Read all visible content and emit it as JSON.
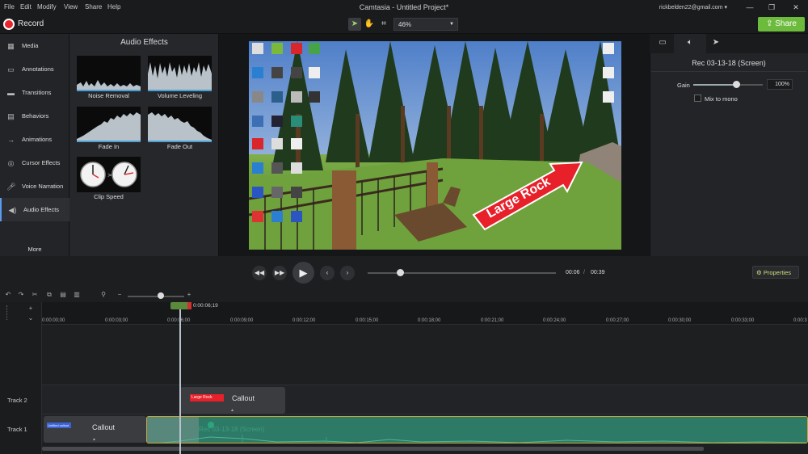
{
  "menu": [
    "File",
    "Edit",
    "Modify",
    "View",
    "Share",
    "Help"
  ],
  "window_title": "Camtasia - Untitled Project*",
  "user_email": "rickbelden22@gmail.com",
  "toolbar": {
    "record_label": "Record",
    "zoom": "46%",
    "share_label": "Share"
  },
  "sidebar": {
    "items": [
      {
        "label": "Media",
        "icon": "film-icon"
      },
      {
        "label": "Annotations",
        "icon": "annotation-icon"
      },
      {
        "label": "Transitions",
        "icon": "transition-icon"
      },
      {
        "label": "Behaviors",
        "icon": "behavior-icon"
      },
      {
        "label": "Animations",
        "icon": "animation-icon"
      },
      {
        "label": "Cursor Effects",
        "icon": "cursor-icon"
      },
      {
        "label": "Voice Narration",
        "icon": "microphone-icon"
      },
      {
        "label": "Audio Effects",
        "icon": "speaker-icon"
      }
    ],
    "active_index": 7,
    "more_label": "More"
  },
  "effects_panel": {
    "title": "Audio Effects",
    "items": [
      "Noise Removal",
      "Volume Leveling",
      "Fade In",
      "Fade Out",
      "Clip Speed"
    ]
  },
  "canvas": {
    "callout_text": "Large Rock"
  },
  "properties": {
    "clip_name": "Rec 03-13-18 (Screen)",
    "gain_label": "Gain",
    "gain_value": "100%",
    "gain_fraction": 0.62,
    "mono_label": "Mix to mono",
    "button_label": "Properties"
  },
  "playback": {
    "current": "00:06",
    "separator": "/",
    "total": "00:39",
    "progress_fraction": 0.17
  },
  "timeline": {
    "playhead_time": "0:00:06;19",
    "ticks": [
      "0:00:00;00",
      "0:00:03;00",
      "0:00:06;00",
      "0:00:09;00",
      "0:00:12;00",
      "0:00:15;00",
      "0:00:18;00",
      "0:00:21;00",
      "0:00:24;00",
      "0:00:27;00",
      "0:00:30;00",
      "0:00:33;00",
      "0:00:3"
    ],
    "tracks": [
      {
        "label": "Track 2",
        "clip_label": "Callout",
        "badge": "Large Rock"
      },
      {
        "label": "Track 1",
        "clip_label": "Callout",
        "badge": "Untitled callout",
        "media_label": "Rec 03-13-18 (Screen)"
      }
    ]
  },
  "colors": {
    "accent": "#6cbb3c",
    "record": "#e6262c",
    "callout": "#e8202a",
    "clip": "#2d7a66"
  }
}
